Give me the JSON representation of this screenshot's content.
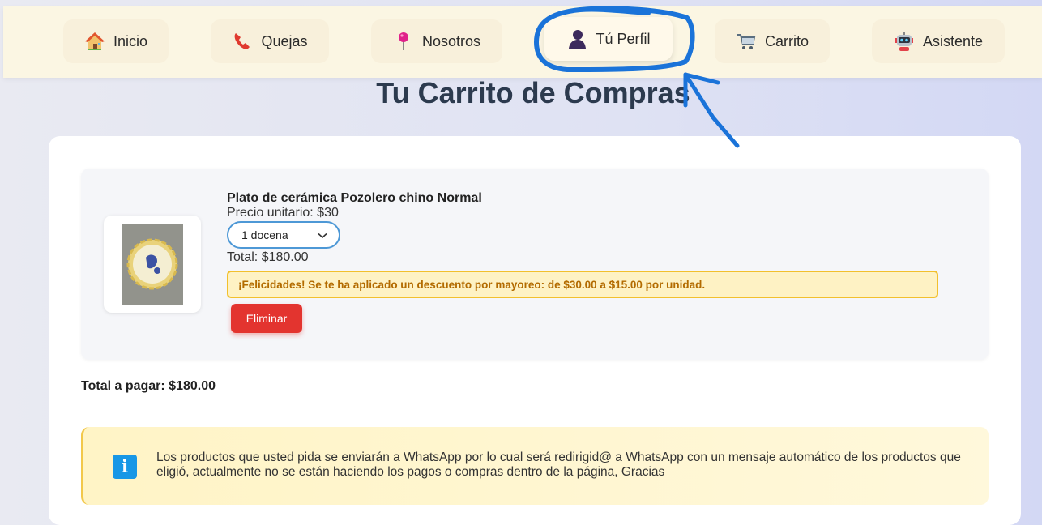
{
  "nav": {
    "items": [
      {
        "label": "Inicio",
        "icon": "house-icon"
      },
      {
        "label": "Quejas",
        "icon": "phone-icon"
      },
      {
        "label": "Nosotros",
        "icon": "pushpin-icon"
      },
      {
        "label": "Tú Perfil",
        "icon": "user-silhouette-icon"
      },
      {
        "label": "Carrito",
        "icon": "shopping-cart-icon"
      },
      {
        "label": "Asistente",
        "icon": "robot-icon"
      }
    ],
    "active": "Tú Perfil"
  },
  "annotation": {
    "color": "#1a73d9",
    "marks": [
      "circle-around-tu-perfil",
      "arrow-pointing-to-tu-perfil"
    ]
  },
  "page": {
    "title": "Tu Carrito de Compras"
  },
  "cart": {
    "items": [
      {
        "name": "Plato de cerámica Pozolero chino Normal",
        "unit_price": "Precio unitario: $30",
        "quantity": "1 docena",
        "total": "Total: $180.00",
        "discount_message": "¡Felicidades! Se te ha aplicado un descuento por mayoreo: de $30.00 a $15.00 por unidad.",
        "remove_label": "Eliminar"
      }
    ],
    "grand_total": "Total a pagar: $180.00"
  },
  "notice": {
    "icon": "info-icon",
    "icon_glyph": "i",
    "text": "Los productos que usted pida se enviarán a WhatsApp por lo cual será redirigid@ a WhatsApp con un mensaje automático de los productos que eligió, actualmente no se están haciendo los pagos o compras dentro de la página, Gracias"
  },
  "colors": {
    "title": "#2c3a4e",
    "remove_button": "#e3342f",
    "discount_border": "#f2c02d",
    "discount_text": "#b36b00",
    "select_border": "#4d98d6",
    "info_icon": "#1897e6"
  }
}
